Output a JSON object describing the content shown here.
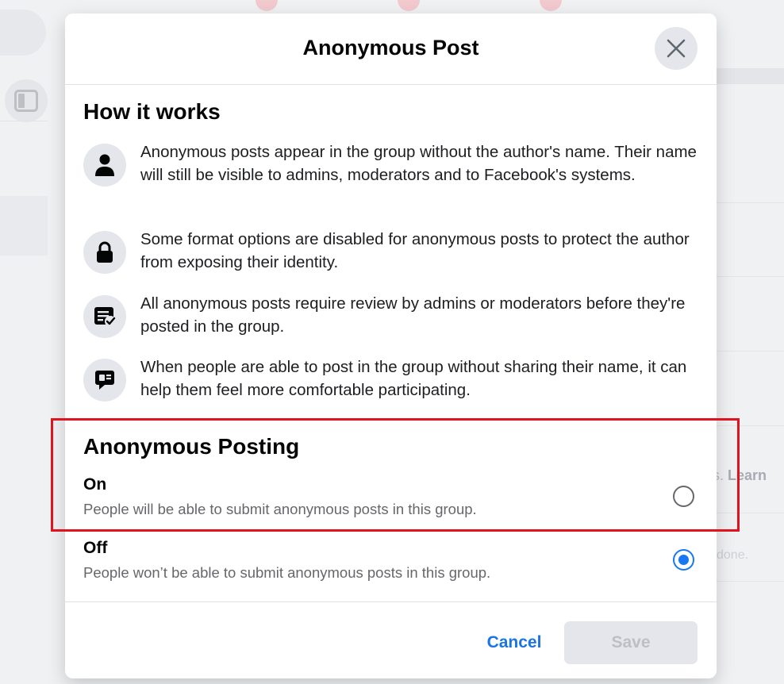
{
  "modal": {
    "title": "Anonymous Post",
    "close_icon": "close-icon"
  },
  "how_it_works": {
    "title": "How it works",
    "items": [
      {
        "icon": "person-icon",
        "text": "Anonymous posts appear in the group without the author's name. Their name will still be visible to admins, moderators and to Facebook's systems."
      },
      {
        "icon": "lock-icon",
        "text": "Some format options are disabled for anonymous posts to protect the author from exposing their identity."
      },
      {
        "icon": "post-review-icon",
        "text": "All anonymous posts require review by admins or moderators before they're posted in the group."
      },
      {
        "icon": "chat-bubble-icon",
        "text": "When people are able to post in the group without sharing their name, it can help them feel more comfortable participating."
      }
    ]
  },
  "anonymous_posting": {
    "title": "Anonymous Posting",
    "options": [
      {
        "label": "On",
        "description": "People will be able to submit anonymous posts in this group.",
        "selected": false
      },
      {
        "label": "Off",
        "description": "People won’t be able to submit anonymous posts in this group.",
        "selected": true
      }
    ]
  },
  "footer": {
    "cancel_label": "Cancel",
    "save_label": "Save"
  },
  "background": {
    "partial_text_1": "s. ",
    "partial_link": "Learn",
    "partial_text_2": "done."
  },
  "colors": {
    "accent": "#1877f2",
    "highlight": "#e0141e",
    "disabled_bg": "#e4e6eb",
    "disabled_text": "#bcc0c4"
  }
}
